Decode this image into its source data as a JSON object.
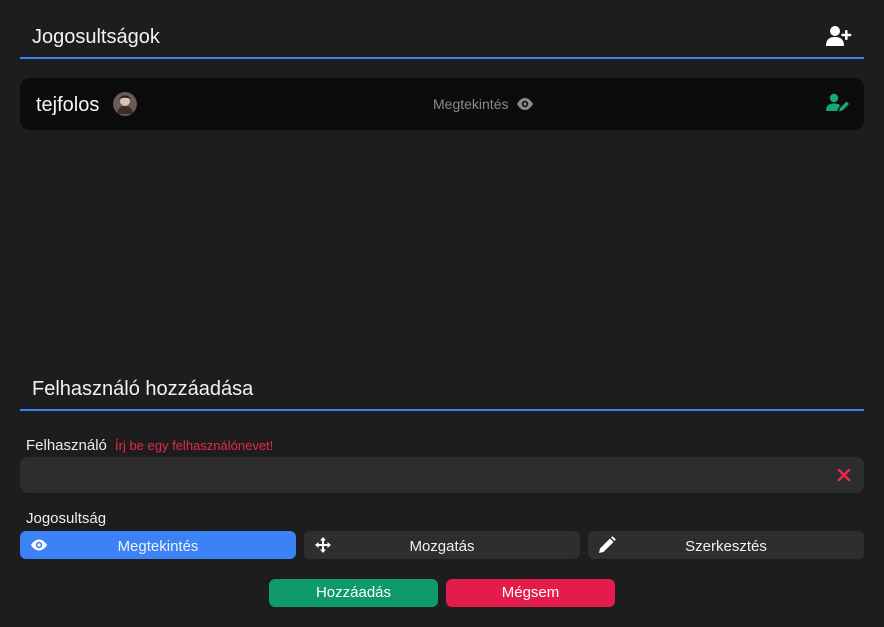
{
  "permissions_section": {
    "title": "Jogosultságok",
    "add_user_icon": "user-plus-icon"
  },
  "permission_entries": [
    {
      "username": "tejfolos",
      "avatar": "avatar-image",
      "level": "Megtekintés",
      "level_icon": "eye-icon",
      "edit_icon": "user-edit-icon"
    }
  ],
  "add_user_section": {
    "title": "Felhasználó hozzáadása",
    "user_field_label": "Felhasználó",
    "user_field_error": "Írj be egy felhasználónevet!",
    "user_field_value": "",
    "clear_icon": "close-icon",
    "permission_label": "Jogosultság",
    "permission_options": [
      {
        "label": "Megtekintés",
        "icon": "eye-icon",
        "selected": true
      },
      {
        "label": "Mozgatás",
        "icon": "move-arrows-icon",
        "selected": false
      },
      {
        "label": "Szerkesztés",
        "icon": "pencil-icon",
        "selected": false
      }
    ],
    "add_button": "Hozzáadás",
    "cancel_button": "Mégsem"
  },
  "colors": {
    "accent": "#3b82f6",
    "success": "#0e9a6a",
    "danger": "#e31c4b",
    "error_text": "#e8274b",
    "edit_icon": "#14a873"
  }
}
